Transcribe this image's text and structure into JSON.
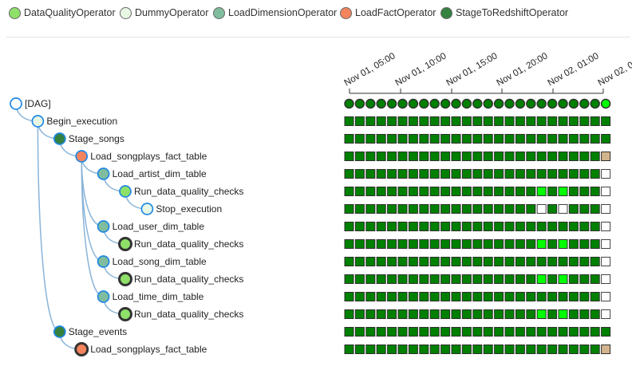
{
  "legend": [
    {
      "label": "DataQualityOperator",
      "color": "#8ee069"
    },
    {
      "label": "DummyOperator",
      "color": "#e8f7e4"
    },
    {
      "label": "LoadDimensionOperator",
      "color": "#80bd9e"
    },
    {
      "label": "LoadFactOperator",
      "color": "#f4845d"
    },
    {
      "label": "StageToRedshiftOperator",
      "color": "#358140"
    }
  ],
  "timeline": {
    "labels": [
      "Nov 01, 05:00",
      "Nov 01, 10:00",
      "Nov 01, 15:00",
      "Nov 01, 20:00",
      "Nov 02, 01:00",
      "Nov 02, 0"
    ]
  },
  "status_colors": {
    "success": "#008000",
    "running": "#00ff00",
    "upstream_failed": "#d2b48c",
    "no_status": "#ffffff"
  },
  "tree": [
    {
      "label": "[DAG]",
      "depth": 0,
      "node_color": "#ffffff",
      "node_border": "#1e88e5",
      "bold_border": false,
      "row_type": "dag",
      "runs": [
        "s",
        "s",
        "s",
        "s",
        "s",
        "s",
        "s",
        "s",
        "s",
        "s",
        "s",
        "s",
        "s",
        "s",
        "s",
        "s",
        "s",
        "s",
        "s",
        "s",
        "s",
        "s",
        "s",
        "s",
        "r"
      ]
    },
    {
      "label": "Begin_execution",
      "depth": 1,
      "node_color": "#e8f7e4",
      "node_border": "#1e88e5",
      "bold_border": false,
      "row_type": "task",
      "runs": [
        "s",
        "s",
        "s",
        "s",
        "s",
        "s",
        "s",
        "s",
        "s",
        "s",
        "s",
        "s",
        "s",
        "s",
        "s",
        "s",
        "s",
        "s",
        "s",
        "s",
        "s",
        "s",
        "s",
        "s",
        "s"
      ]
    },
    {
      "label": "Stage_songs",
      "depth": 2,
      "node_color": "#358140",
      "node_border": "#1e88e5",
      "bold_border": false,
      "row_type": "task",
      "runs": [
        "s",
        "s",
        "s",
        "s",
        "s",
        "s",
        "s",
        "s",
        "s",
        "s",
        "s",
        "s",
        "s",
        "s",
        "s",
        "s",
        "s",
        "s",
        "s",
        "s",
        "s",
        "s",
        "s",
        "s",
        "s"
      ]
    },
    {
      "label": "Load_songplays_fact_table",
      "depth": 3,
      "node_color": "#f4845d",
      "node_border": "#1e88e5",
      "bold_border": false,
      "row_type": "task",
      "runs": [
        "s",
        "s",
        "s",
        "s",
        "s",
        "s",
        "s",
        "s",
        "s",
        "s",
        "s",
        "s",
        "s",
        "s",
        "s",
        "s",
        "s",
        "s",
        "s",
        "s",
        "s",
        "s",
        "s",
        "s",
        "u"
      ]
    },
    {
      "label": "Load_artist_dim_table",
      "depth": 4,
      "node_color": "#80bd9e",
      "node_border": "#1e88e5",
      "bold_border": false,
      "row_type": "task",
      "runs": [
        "s",
        "s",
        "s",
        "s",
        "s",
        "s",
        "s",
        "s",
        "s",
        "s",
        "s",
        "s",
        "s",
        "s",
        "s",
        "s",
        "s",
        "s",
        "s",
        "s",
        "s",
        "s",
        "s",
        "s",
        "n"
      ]
    },
    {
      "label": "Run_data_quality_checks",
      "depth": 5,
      "node_color": "#8ee069",
      "node_border": "#1e88e5",
      "bold_border": false,
      "row_type": "task",
      "runs": [
        "s",
        "s",
        "s",
        "s",
        "s",
        "s",
        "s",
        "s",
        "s",
        "s",
        "s",
        "s",
        "s",
        "s",
        "s",
        "s",
        "s",
        "s",
        "r",
        "s",
        "r",
        "s",
        "s",
        "s",
        "n"
      ]
    },
    {
      "label": "Stop_execution",
      "depth": 6,
      "node_color": "#e8f7e4",
      "node_border": "#1e88e5",
      "bold_border": false,
      "row_type": "task",
      "runs": [
        "s",
        "s",
        "s",
        "s",
        "s",
        "s",
        "s",
        "s",
        "s",
        "s",
        "s",
        "s",
        "s",
        "s",
        "s",
        "s",
        "s",
        "s",
        "n",
        "s",
        "n",
        "s",
        "s",
        "s",
        "n"
      ]
    },
    {
      "label": "Load_user_dim_table",
      "depth": 4,
      "node_color": "#80bd9e",
      "node_border": "#1e88e5",
      "bold_border": false,
      "row_type": "task",
      "runs": [
        "s",
        "s",
        "s",
        "s",
        "s",
        "s",
        "s",
        "s",
        "s",
        "s",
        "s",
        "s",
        "s",
        "s",
        "s",
        "s",
        "s",
        "s",
        "s",
        "s",
        "s",
        "s",
        "s",
        "s",
        "n"
      ]
    },
    {
      "label": "Run_data_quality_checks",
      "depth": 5,
      "node_color": "#8ee069",
      "node_border": "#333333",
      "bold_border": true,
      "row_type": "task",
      "runs": [
        "s",
        "s",
        "s",
        "s",
        "s",
        "s",
        "s",
        "s",
        "s",
        "s",
        "s",
        "s",
        "s",
        "s",
        "s",
        "s",
        "s",
        "s",
        "r",
        "s",
        "r",
        "s",
        "s",
        "s",
        "n"
      ]
    },
    {
      "label": "Load_song_dim_table",
      "depth": 4,
      "node_color": "#80bd9e",
      "node_border": "#1e88e5",
      "bold_border": false,
      "row_type": "task",
      "runs": [
        "s",
        "s",
        "s",
        "s",
        "s",
        "s",
        "s",
        "s",
        "s",
        "s",
        "s",
        "s",
        "s",
        "s",
        "s",
        "s",
        "s",
        "s",
        "s",
        "s",
        "s",
        "s",
        "s",
        "s",
        "n"
      ]
    },
    {
      "label": "Run_data_quality_checks",
      "depth": 5,
      "node_color": "#8ee069",
      "node_border": "#333333",
      "bold_border": true,
      "row_type": "task",
      "runs": [
        "s",
        "s",
        "s",
        "s",
        "s",
        "s",
        "s",
        "s",
        "s",
        "s",
        "s",
        "s",
        "s",
        "s",
        "s",
        "s",
        "s",
        "s",
        "r",
        "s",
        "r",
        "s",
        "s",
        "s",
        "n"
      ]
    },
    {
      "label": "Load_time_dim_table",
      "depth": 4,
      "node_color": "#80bd9e",
      "node_border": "#1e88e5",
      "bold_border": false,
      "row_type": "task",
      "runs": [
        "s",
        "s",
        "s",
        "s",
        "s",
        "s",
        "s",
        "s",
        "s",
        "s",
        "s",
        "s",
        "s",
        "s",
        "s",
        "s",
        "s",
        "s",
        "s",
        "s",
        "s",
        "s",
        "s",
        "s",
        "n"
      ]
    },
    {
      "label": "Run_data_quality_checks",
      "depth": 5,
      "node_color": "#8ee069",
      "node_border": "#333333",
      "bold_border": true,
      "row_type": "task",
      "runs": [
        "s",
        "s",
        "s",
        "s",
        "s",
        "s",
        "s",
        "s",
        "s",
        "s",
        "s",
        "s",
        "s",
        "s",
        "s",
        "s",
        "s",
        "s",
        "r",
        "s",
        "r",
        "s",
        "s",
        "s",
        "n"
      ]
    },
    {
      "label": "Stage_events",
      "depth": 2,
      "node_color": "#358140",
      "node_border": "#1e88e5",
      "bold_border": false,
      "row_type": "task",
      "runs": [
        "s",
        "s",
        "s",
        "s",
        "s",
        "s",
        "s",
        "s",
        "s",
        "s",
        "s",
        "s",
        "s",
        "s",
        "s",
        "s",
        "s",
        "s",
        "s",
        "s",
        "s",
        "s",
        "s",
        "s",
        "s"
      ]
    },
    {
      "label": "Load_songplays_fact_table",
      "depth": 3,
      "node_color": "#f4845d",
      "node_border": "#333333",
      "bold_border": true,
      "row_type": "task",
      "runs": [
        "s",
        "s",
        "s",
        "s",
        "s",
        "s",
        "s",
        "s",
        "s",
        "s",
        "s",
        "s",
        "s",
        "s",
        "s",
        "s",
        "s",
        "s",
        "s",
        "s",
        "s",
        "s",
        "s",
        "s",
        "u"
      ]
    }
  ]
}
